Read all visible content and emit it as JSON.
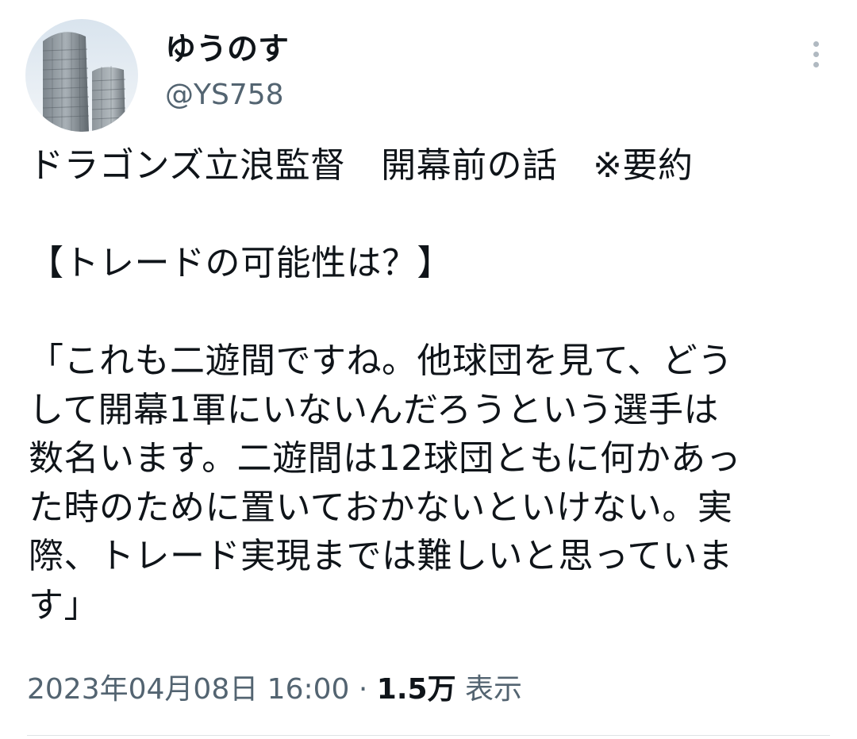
{
  "author": {
    "display_name": "ゆうのす",
    "handle": "@YS758",
    "avatar_icon": "tower-buildings-photo"
  },
  "tweet": {
    "lines": [
      "ドラゴンズ立浪監督　開幕前の話　※要約",
      "",
      "【トレードの可能性は？】",
      "",
      "「これも二遊間ですね。他球団を見て、どう",
      "して開幕1軍にいないんだろうという選手は",
      "数名います。二遊間は12球団ともに何かあっ",
      "た時のために置いておかないといけない。実",
      "際、トレード実現までは難しいと思っていま",
      "す」"
    ]
  },
  "meta": {
    "timestamp": "2023年04月08日 16:00",
    "separator": "·",
    "views_count": "1.5万",
    "views_label": "表示"
  },
  "colors": {
    "text_primary": "#0f1419",
    "text_secondary": "#536471",
    "divider": "#dfe3e6",
    "more_icon": "#b0b9c1"
  }
}
